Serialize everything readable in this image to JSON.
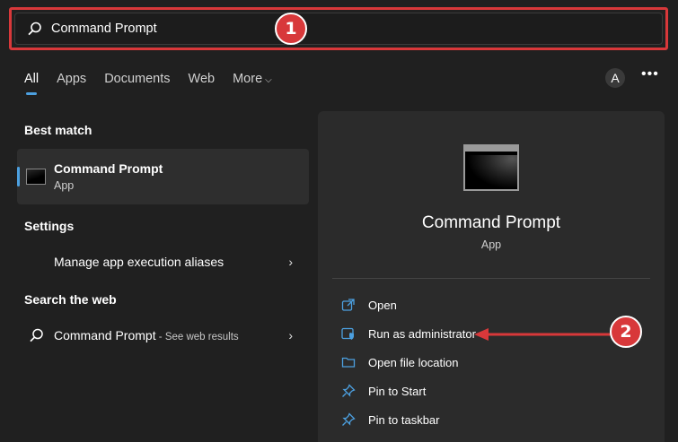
{
  "search": {
    "value": "Command Prompt"
  },
  "annotations": {
    "badge1": "1",
    "badge2": "2"
  },
  "tabs": [
    {
      "label": "All",
      "active": true
    },
    {
      "label": "Apps"
    },
    {
      "label": "Documents"
    },
    {
      "label": "Web"
    },
    {
      "label": "More"
    }
  ],
  "header": {
    "avatar": "A",
    "more_dots": "•••"
  },
  "left": {
    "best_match_title": "Best match",
    "best_match": {
      "title": "Command Prompt",
      "subtitle": "App"
    },
    "settings_title": "Settings",
    "settings_item": "Manage app execution aliases",
    "web_title": "Search the web",
    "web_item": {
      "label": "Command Prompt",
      "hint": " - See web results"
    },
    "chevron": "›"
  },
  "right": {
    "title": "Command Prompt",
    "subtitle": "App",
    "actions": [
      {
        "label": "Open",
        "icon": "open-icon"
      },
      {
        "label": "Run as administrator",
        "icon": "shield-icon"
      },
      {
        "label": "Open file location",
        "icon": "folder-icon"
      },
      {
        "label": "Pin to Start",
        "icon": "pin-icon"
      },
      {
        "label": "Pin to taskbar",
        "icon": "pin-icon"
      }
    ]
  },
  "colors": {
    "accent": "#4ca0e0",
    "annotation": "#d8383a",
    "background": "#202020"
  }
}
